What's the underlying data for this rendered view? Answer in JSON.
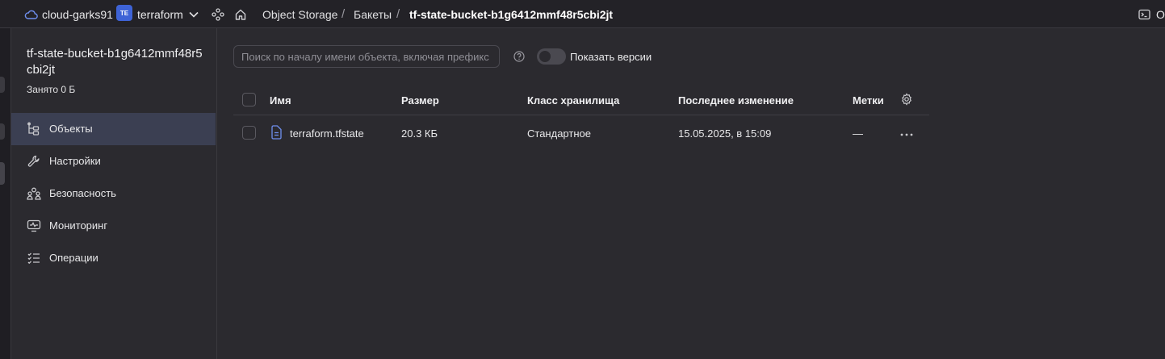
{
  "header": {
    "cloud_name": "cloud-garks91",
    "folder_badge": "TE",
    "folder_name": "terraform",
    "breadcrumbs": [
      "Object Storage",
      "Бакеты",
      "tf-state-bucket-b1g6412mmf48r5cbi2jt"
    ],
    "separator": "/",
    "right_label": "О",
    "icons": [
      "cloud-icon",
      "chevron-down-icon",
      "org-icon",
      "home-icon",
      "terminal-icon"
    ]
  },
  "sidebar": {
    "bucket_name": "tf-state-bucket-b1g6412mmf48r5cbi2jt",
    "used": "Занято 0 Б",
    "items": [
      {
        "label": "Объекты",
        "icon": "objects-icon",
        "active": true
      },
      {
        "label": "Настройки",
        "icon": "wrench-icon",
        "active": false
      },
      {
        "label": "Безопасность",
        "icon": "users-icon",
        "active": false
      },
      {
        "label": "Мониторинг",
        "icon": "monitoring-icon",
        "active": false
      },
      {
        "label": "Операции",
        "icon": "operations-icon",
        "active": false
      }
    ]
  },
  "toolbar": {
    "search_placeholder": "Поиск по началу имени объекта, включая префикс",
    "show_versions_label": "Показать версии",
    "show_versions_on": false
  },
  "table": {
    "columns": [
      "Имя",
      "Размер",
      "Класс хранилища",
      "Последнее изменение",
      "Метки"
    ],
    "rows": [
      {
        "name": "terraform.tfstate",
        "size": "20.3 КБ",
        "storage_class": "Стандартное",
        "modified": "15.05.2025, в 15:09",
        "labels": "—"
      }
    ]
  },
  "colors": {
    "accent": "#3e63d6",
    "active_nav": "#3b3f52",
    "background": "#2b2a2f"
  }
}
